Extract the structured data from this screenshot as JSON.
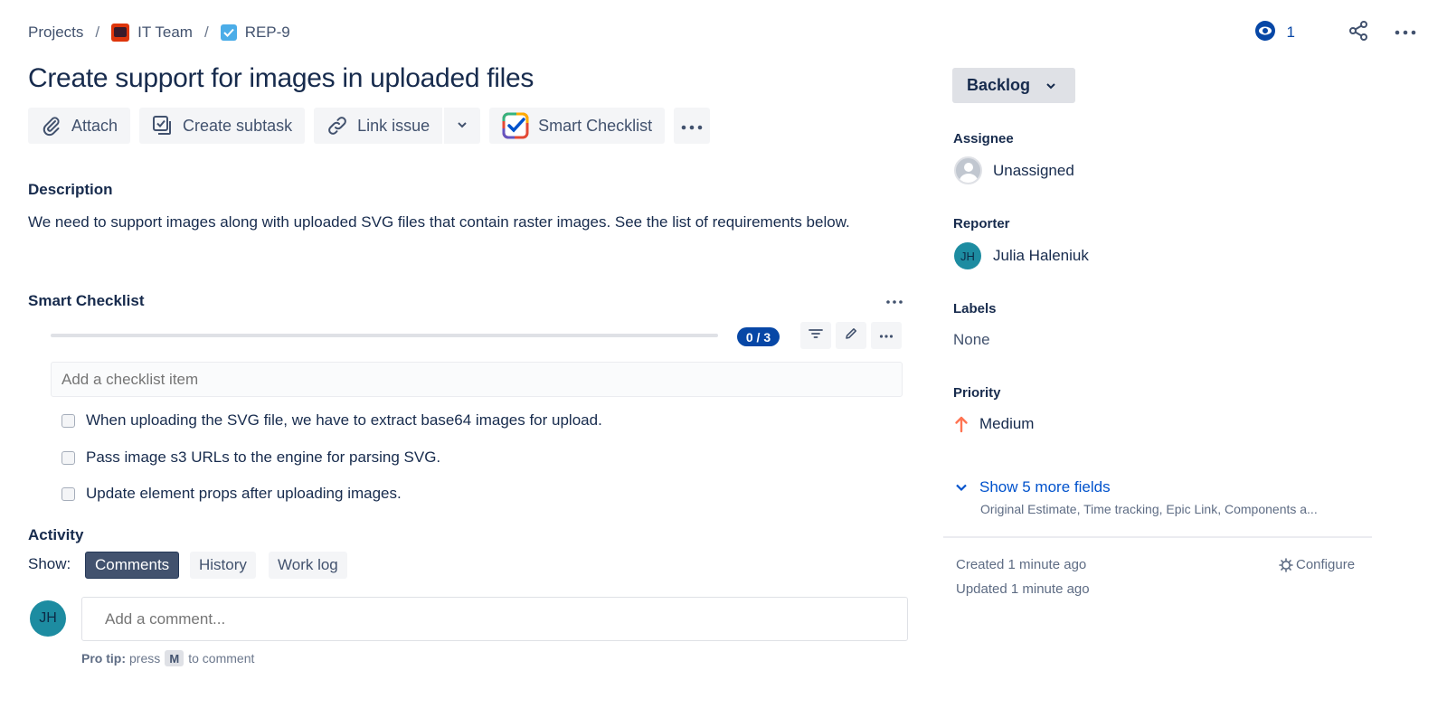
{
  "breadcrumb": {
    "projects": "Projects",
    "separator": "/",
    "project": "IT Team",
    "issue_key": "REP-9"
  },
  "watchers": {
    "count": "1"
  },
  "issue": {
    "title": "Create support for images in uploaded files"
  },
  "toolbar": {
    "attach": "Attach",
    "create_subtask": "Create subtask",
    "link_issue": "Link issue",
    "smart_checklist": "Smart Checklist"
  },
  "description": {
    "label": "Description",
    "text": "We need to support images along with uploaded SVG files that contain raster images. See the list of requirements below."
  },
  "smart_checklist": {
    "label": "Smart Checklist",
    "progress_badge": "0 / 3",
    "progress_fraction": 0,
    "placeholder": "Add a checklist item",
    "items": [
      {
        "text": "When uploading the SVG file, we have to extract base64 images for upload.",
        "checked": false
      },
      {
        "text": "Pass image s3 URLs to the engine for parsing SVG.",
        "checked": false
      },
      {
        "text": "Update element props after uploading images.",
        "checked": false
      }
    ]
  },
  "activity": {
    "label": "Activity",
    "show_label": "Show:",
    "filters": [
      "Comments",
      "History",
      "Work log"
    ],
    "active_filter": "Comments",
    "comment_placeholder": "Add a comment...",
    "avatar_initials": "JH",
    "protip_label": "Pro tip:",
    "protip_press": "press",
    "protip_key": "M",
    "protip_suffix": "to comment"
  },
  "sidebar": {
    "status": "Backlog",
    "assignee_label": "Assignee",
    "assignee": "Unassigned",
    "reporter_label": "Reporter",
    "reporter": "Julia Haleniuk",
    "reporter_initials": "JH",
    "labels_label": "Labels",
    "labels": "None",
    "priority_label": "Priority",
    "priority": "Medium",
    "show_more": "Show 5 more fields",
    "show_more_sub": "Original Estimate, Time tracking, Epic Link, Components a...",
    "created": "Created 1 minute ago",
    "updated": "Updated 1 minute ago",
    "configure": "Configure"
  },
  "colors": {
    "link_blue": "#0052cc",
    "badge_blue": "#0747a6",
    "priority_medium": "#ff7452",
    "avatar_teal": "#1d8ca1",
    "project_red": "#de350b",
    "task_blue": "#4bade8"
  }
}
